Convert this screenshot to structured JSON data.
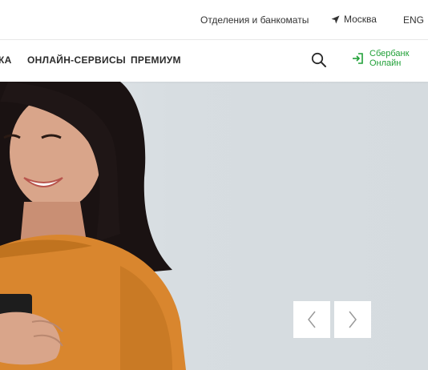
{
  "topbar": {
    "branches_label": "Отделения и банкоматы",
    "city_label": "Москва",
    "lang_label": "ENG"
  },
  "nav": {
    "partial_item_label": "КА",
    "online_services_label": "ОНЛАЙН-СЕРВИСЫ",
    "premium_label": "ПРЕМИУМ",
    "sbol_line1": "Сбербанк",
    "sbol_line2": "Онлайн"
  },
  "colors": {
    "brand_green": "#21a038",
    "text_dark": "#2b2b2b",
    "hero_bg": "#d5dbdf"
  },
  "icons": {
    "location": "location-arrow-icon",
    "search": "search-icon",
    "login": "login-arrow-icon",
    "prev": "chevron-left-icon",
    "next": "chevron-right-icon"
  }
}
